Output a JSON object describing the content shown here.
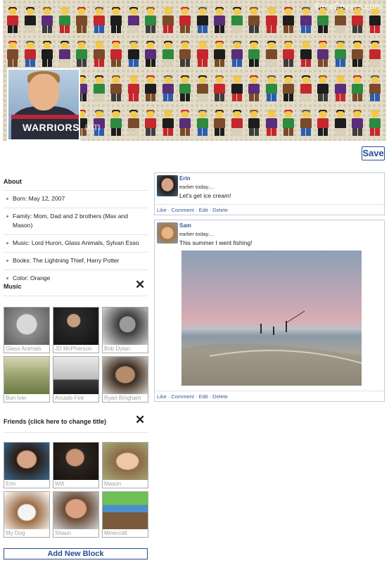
{
  "cover": {
    "watermark": "FaceCovers.com",
    "name_overlay": "am"
  },
  "profile_photo": {
    "shirt_text": "WARRIORS"
  },
  "save_label": "Save",
  "about": {
    "title": "About",
    "items": [
      "Born: May 12, 2007",
      "Family: Mom, Dad and 2 brothers (Max and Mason)",
      "Music: Lord Huron, Glass Animals, Sylvan Esso",
      "Books: The Lightning Thief, Harry Potter",
      "Color: Orange"
    ]
  },
  "music": {
    "title": "Music",
    "close_icon": "close-icon",
    "tiles": [
      "Glass Animals",
      "JD McPherson",
      "Bob Dylan",
      "Bon Iver",
      "Arcade Fire",
      "Ryan Bingham"
    ]
  },
  "friends": {
    "title": "Friends (click here to change title)",
    "close_icon": "close-icon",
    "tiles": [
      "Erin",
      "Will",
      "Mason",
      "My Dog",
      "Shaun",
      "Minecraft"
    ]
  },
  "add_block_label": "Add New Block",
  "posts": [
    {
      "author": "Erin",
      "time": "earlier today....",
      "text": "Let's get ice cream!",
      "actions": "Like · Comment · Edit · Delete",
      "has_photo": false
    },
    {
      "author": "Sam",
      "time": "earlier today....",
      "text": "This summer I went fishing!",
      "actions": "Like · Comment · Edit · Delete",
      "has_photo": true
    }
  ],
  "colors": {
    "link": "#3b5998",
    "button_border": "#274e92"
  }
}
